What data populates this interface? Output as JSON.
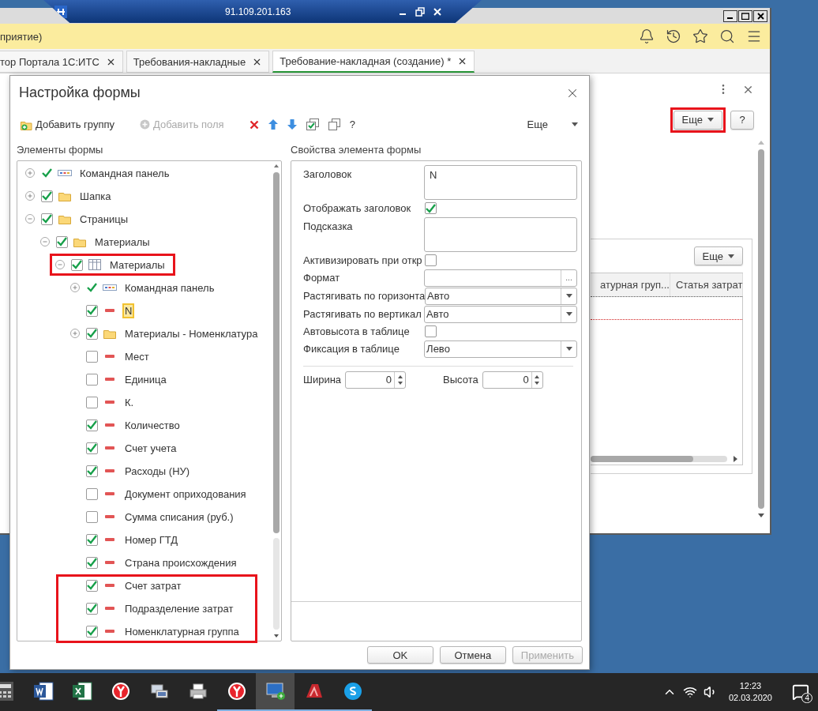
{
  "remote_bar": {
    "address": "91.109.201.163"
  },
  "app": {
    "header_title": "приятие)",
    "tabs": [
      {
        "label": "тор Портала 1С:ИТС",
        "selected": false
      },
      {
        "label": "Требования-накладные",
        "selected": false
      },
      {
        "label": "Требование-накладная (создание) *",
        "selected": true
      }
    ],
    "more_button": {
      "label": "Еще",
      "annotated": true
    },
    "help_button": {
      "label": "?"
    },
    "table_panel": {
      "more_button": {
        "label": "Еще"
      },
      "columns": [
        "атурная груп...",
        "Статья затрат"
      ]
    }
  },
  "dialog": {
    "title": "Настройка формы",
    "toolbar": [
      {
        "kind": "add-group",
        "label": "Добавить группу",
        "disabled": false
      },
      {
        "kind": "add-field",
        "label": "Добавить поля",
        "disabled": true
      },
      {
        "kind": "delete"
      },
      {
        "kind": "up"
      },
      {
        "kind": "down"
      },
      {
        "kind": "check-all"
      },
      {
        "kind": "copy"
      },
      {
        "kind": "help",
        "label": "?"
      }
    ],
    "more": {
      "label": "Еще"
    },
    "elements_title": "Элементы формы",
    "tree": [
      {
        "label": "Командная панель",
        "kind": "command-panel",
        "checked": true,
        "expanded": false,
        "selected": false,
        "annotated": false
      },
      {
        "label": "Шапка",
        "kind": "folder",
        "checked": true,
        "expanded": false,
        "selected": false,
        "annotated": false
      },
      {
        "label": "Страницы",
        "kind": "folder",
        "checked": true,
        "expanded": true,
        "selected": false,
        "annotated": false,
        "children": [
          {
            "label": "Материалы",
            "kind": "folder",
            "checked": true,
            "expanded": true,
            "selected": false,
            "annotated": false,
            "children": [
              {
                "label": "Материалы",
                "kind": "table",
                "checked": true,
                "expanded": true,
                "selected": false,
                "annotated": true,
                "children": [
                  {
                    "label": "Командная панель",
                    "kind": "command-panel",
                    "checked": true,
                    "expanded": false,
                    "selected": false,
                    "annotated": false
                  },
                  {
                    "label": "N",
                    "kind": "field",
                    "checked": true,
                    "selected": true,
                    "annotated": false
                  },
                  {
                    "label": "Материалы - Номенклатура",
                    "kind": "folder",
                    "checked": true,
                    "expanded": false,
                    "selected": false,
                    "annotated": false
                  },
                  {
                    "label": "Мест",
                    "kind": "field",
                    "checked": false,
                    "selected": false,
                    "annotated": false
                  },
                  {
                    "label": "Единица",
                    "kind": "field",
                    "checked": false,
                    "selected": false,
                    "annotated": false
                  },
                  {
                    "label": "К.",
                    "kind": "field",
                    "checked": false,
                    "selected": false,
                    "annotated": false
                  },
                  {
                    "label": "Количество",
                    "kind": "field",
                    "checked": true,
                    "selected": false,
                    "annotated": false
                  },
                  {
                    "label": "Счет учета",
                    "kind": "field",
                    "checked": true,
                    "selected": false,
                    "annotated": false
                  },
                  {
                    "label": "Расходы (НУ)",
                    "kind": "field",
                    "checked": true,
                    "selected": false,
                    "annotated": false
                  },
                  {
                    "label": "Документ оприходования",
                    "kind": "field",
                    "checked": false,
                    "selected": false,
                    "annotated": false
                  },
                  {
                    "label": "Сумма списания (руб.)",
                    "kind": "field",
                    "checked": false,
                    "selected": false,
                    "annotated": false
                  },
                  {
                    "label": "Номер ГТД",
                    "kind": "field",
                    "checked": true,
                    "selected": false,
                    "annotated": false
                  },
                  {
                    "label": "Страна происхождения",
                    "kind": "field",
                    "checked": true,
                    "selected": false,
                    "annotated": false
                  },
                  {
                    "label": "Счет затрат",
                    "kind": "field",
                    "checked": true,
                    "selected": false,
                    "annotated": true
                  },
                  {
                    "label": "Подразделение затрат",
                    "kind": "field",
                    "checked": true,
                    "selected": false,
                    "annotated": true
                  },
                  {
                    "label": "Номенклатурная группа",
                    "kind": "field",
                    "checked": true,
                    "selected": false,
                    "annotated": true
                  }
                ]
              }
            ]
          }
        ]
      }
    ],
    "properties_title": "Свойства элемента формы",
    "properties": [
      {
        "kind": "text-area",
        "label": "Заголовок",
        "value": "N"
      },
      {
        "kind": "checkbox",
        "label": "Отображать заголовок",
        "checked": true
      },
      {
        "kind": "text-area",
        "label": "Подсказка"
      },
      {
        "kind": "checkbox",
        "label": "Активизировать при откр",
        "checked": false
      },
      {
        "kind": "choice",
        "label": "Формат",
        "button": "..."
      },
      {
        "kind": "select",
        "label": "Растягивать по горизонта",
        "value": "Авто"
      },
      {
        "kind": "select",
        "label": "Растягивать по вертикал",
        "value": "Авто"
      },
      {
        "kind": "checkbox",
        "label": "Автовысота в таблице",
        "checked": false
      },
      {
        "kind": "select",
        "label": "Фиксация в таблице",
        "value": "Лево"
      }
    ],
    "size": [
      {
        "label": "Ширина",
        "value": "0"
      },
      {
        "label": "Высота",
        "value": "0"
      }
    ],
    "buttons": [
      {
        "label": "OK",
        "disabled": false
      },
      {
        "label": "Отмена",
        "disabled": false
      },
      {
        "label": "Применить",
        "disabled": true
      }
    ]
  },
  "taskbar": {
    "apps": [
      {
        "kind": "calculator",
        "selected": false,
        "running": false
      },
      {
        "kind": "document",
        "selected": false,
        "running": false
      },
      {
        "kind": "spreadsheet",
        "selected": false,
        "running": false
      },
      {
        "kind": "browser",
        "selected": false,
        "running": false
      },
      {
        "kind": "computer",
        "selected": false,
        "running": false
      },
      {
        "kind": "printer",
        "selected": false,
        "running": false
      },
      {
        "kind": "browser",
        "selected": false,
        "running": true
      },
      {
        "kind": "remote",
        "selected": true,
        "running": true
      },
      {
        "kind": "red-app",
        "selected": false,
        "running": true
      },
      {
        "kind": "chat",
        "selected": false,
        "running": true
      }
    ],
    "time": "12:23",
    "date": "02.03.2020",
    "notifications": "4"
  }
}
